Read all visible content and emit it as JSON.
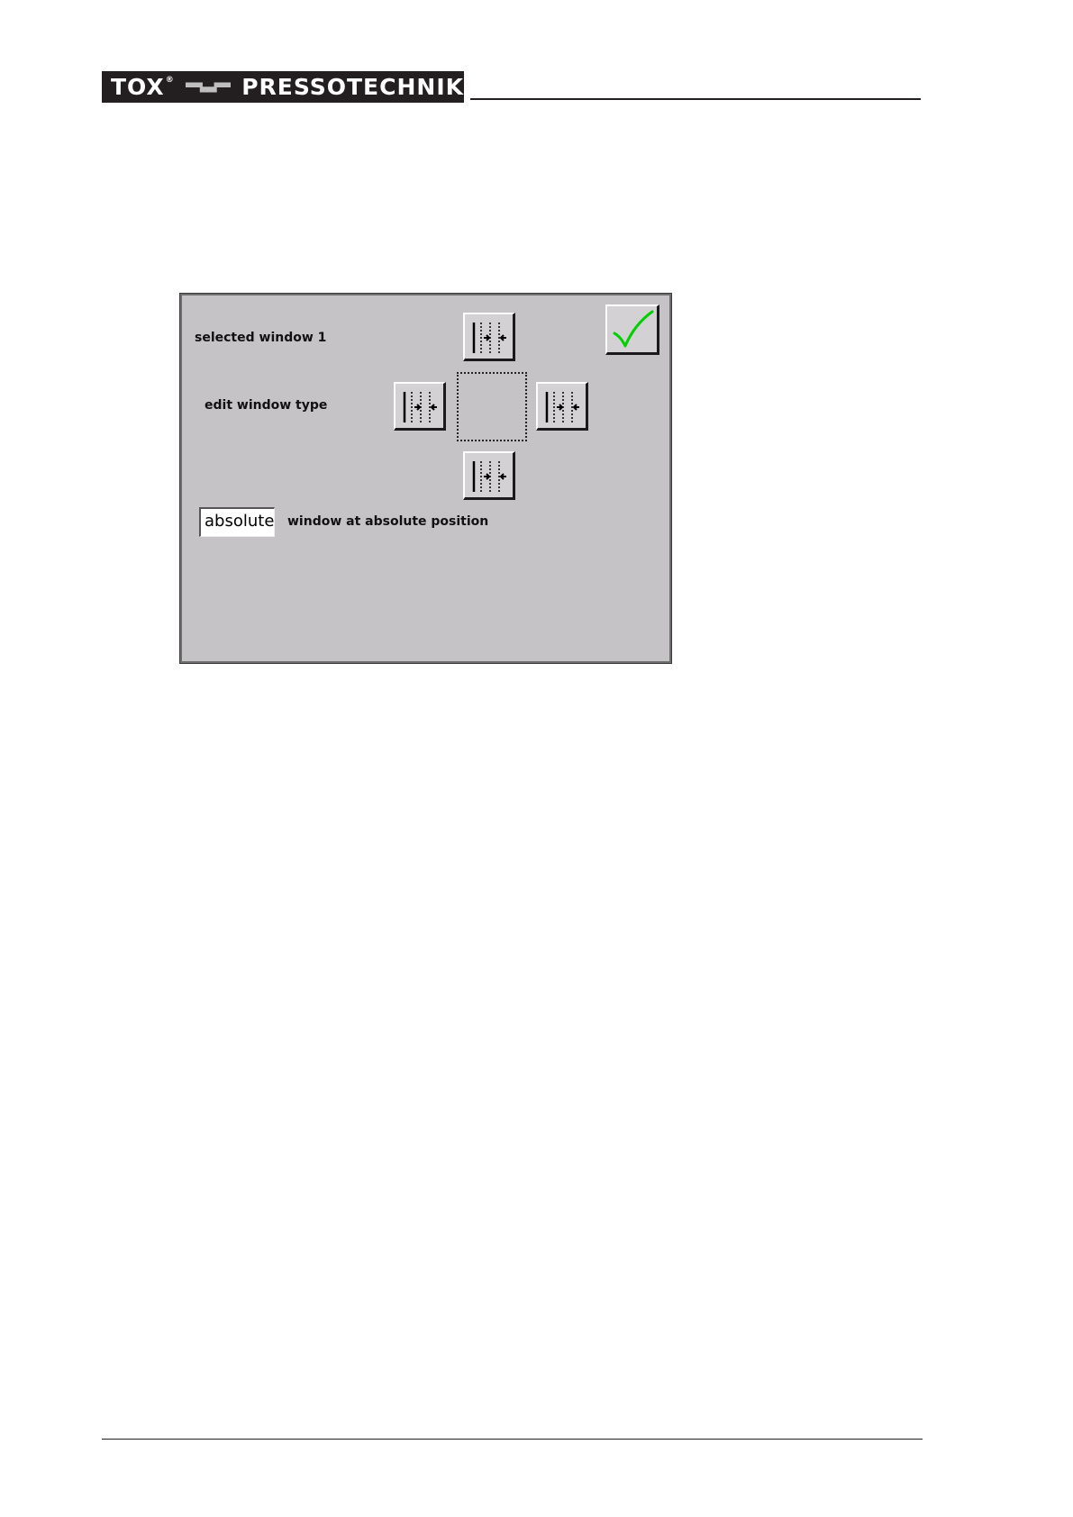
{
  "header": {
    "brand_left": "TOX",
    "brand_reg": "®",
    "brand_right": "PRESSOTECHNIK"
  },
  "dialog": {
    "selected_window_label": "selected window 1",
    "edit_window_type_label": "edit window type",
    "mode_value": "absolute",
    "mode_description": "window at absolute position",
    "check_color": "#00d000"
  },
  "icons": {
    "top": "window-edge-top-icon",
    "left": "window-edge-left-icon",
    "right": "window-edge-right-icon",
    "bottom": "window-edge-bottom-icon",
    "confirm": "checkmark-icon"
  }
}
